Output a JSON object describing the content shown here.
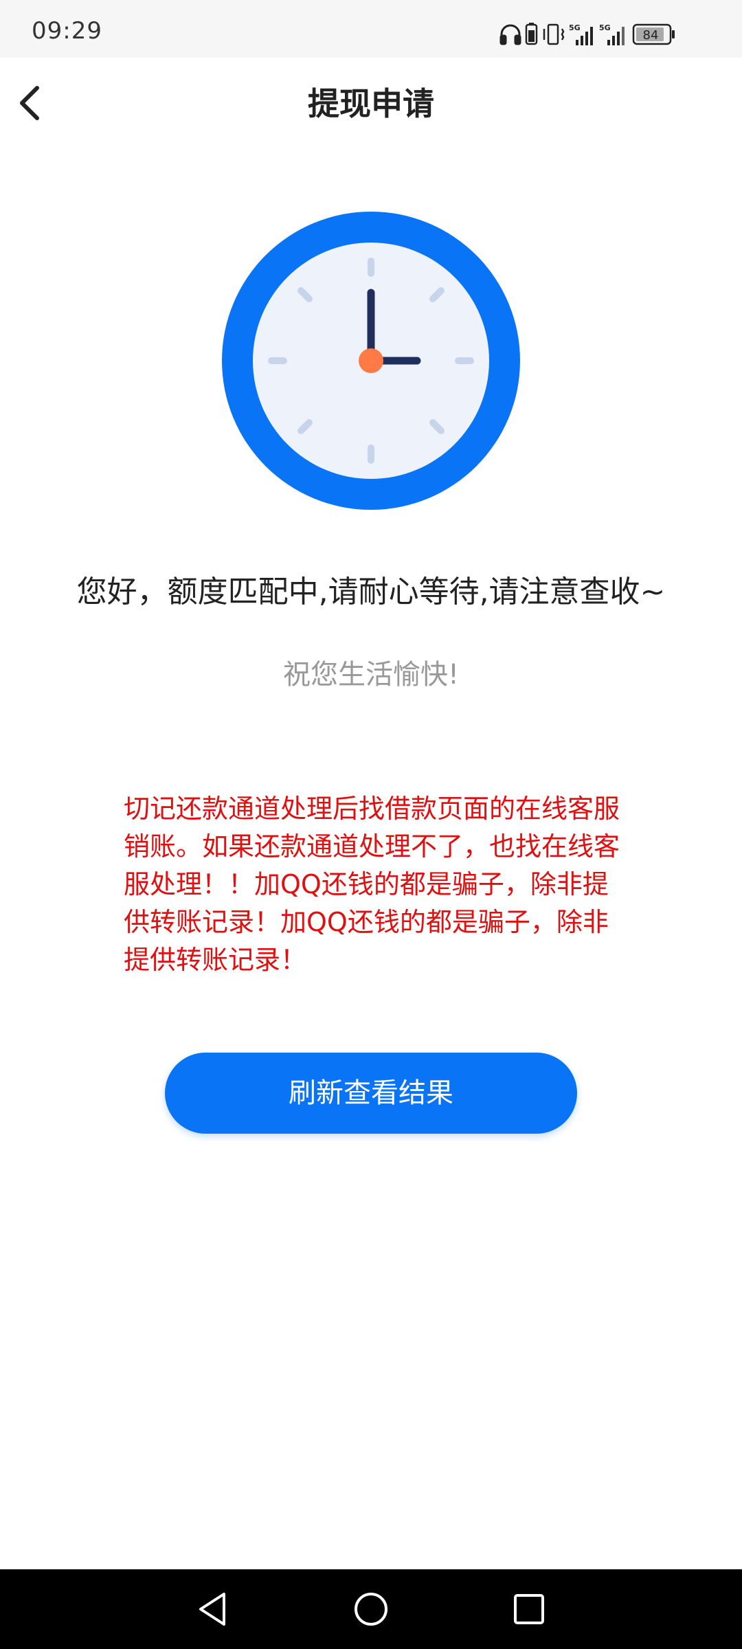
{
  "status_bar": {
    "time": "09:29",
    "battery_level": "84",
    "signal_label_1": "5G",
    "signal_label_2": "5G",
    "icons": [
      "headphones-icon",
      "battery-saver-icon",
      "vibrate-icon",
      "signal-5g-icon",
      "signal-5g-icon",
      "battery-icon"
    ]
  },
  "header": {
    "title": "提现申请",
    "back_icon": "chevron-left-icon"
  },
  "main": {
    "illustration": "clock-icon",
    "status_message": "您好，额度匹配中,请耐心等待,请注意查收~",
    "greeting": "祝您生活愉快!",
    "warning": "切记还款通道处理后找借款页面的在线客服销账。如果还款通道处理不了，也找在线客服处理！！加QQ还钱的都是骗子，除非提供转账记录！加QQ还钱的都是骗子，除非提供转账记录！",
    "refresh_button_label": "刷新查看结果"
  },
  "nav_bar": {
    "buttons": [
      "back-triangle-icon",
      "home-circle-icon",
      "recents-square-icon"
    ]
  },
  "colors": {
    "accent": "#0a74f6",
    "warning": "#e01010",
    "clock_face": "#eef2fa",
    "clock_hands": "#1e2f5e",
    "clock_center": "#ff7a45",
    "nav_bar": "#000000"
  }
}
